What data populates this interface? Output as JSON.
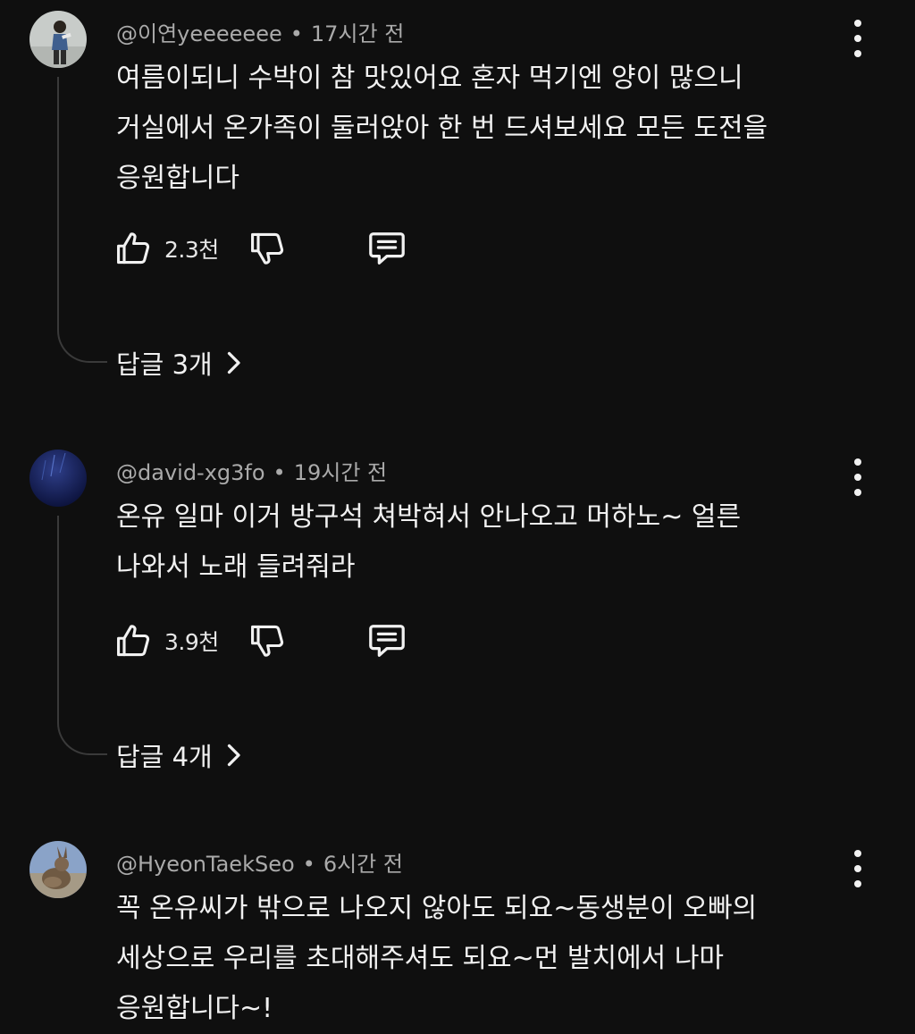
{
  "comments": [
    {
      "author": "@이연yeeeeeee",
      "separator": "•",
      "time": "17시간 전",
      "text": "여름이되니 수박이 참 맛있어요 혼자 먹기엔 양이 많으니\n거실에서 온가족이 둘러앉아 한 번 드셔보세요 모든 도전을\n응원합니다",
      "likes": "2.3천",
      "replies_label": "답글 3개"
    },
    {
      "author": "@david-xg3fo",
      "separator": "•",
      "time": "19시간 전",
      "text": "온유 일마 이거 방구석 쳐박혀서 안나오고 머하노~ 얼른\n나와서 노래 들려줘라",
      "likes": "3.9천",
      "replies_label": "답글 4개"
    },
    {
      "author": "@HyeonTaekSeo",
      "separator": "•",
      "time": "6시간 전",
      "text": "꼭 온유씨가 밖으로 나오지 않아도 되요~동생분이 오빠의\n세상으로 우리를 초대해주셔도 되요~먼 발치에서 나마\n응원합니다~!"
    }
  ],
  "icons": {
    "like": "thumbs-up-icon",
    "dislike": "thumbs-down-icon",
    "reply": "comment-reply-icon",
    "menu": "more-vertical-icon",
    "chevron": "chevron-right-icon"
  },
  "colors": {
    "background": "#0f0f0f",
    "text": "#f1f1f1",
    "meta": "#aaaaaa",
    "thread_line": "#3a3a3a"
  }
}
